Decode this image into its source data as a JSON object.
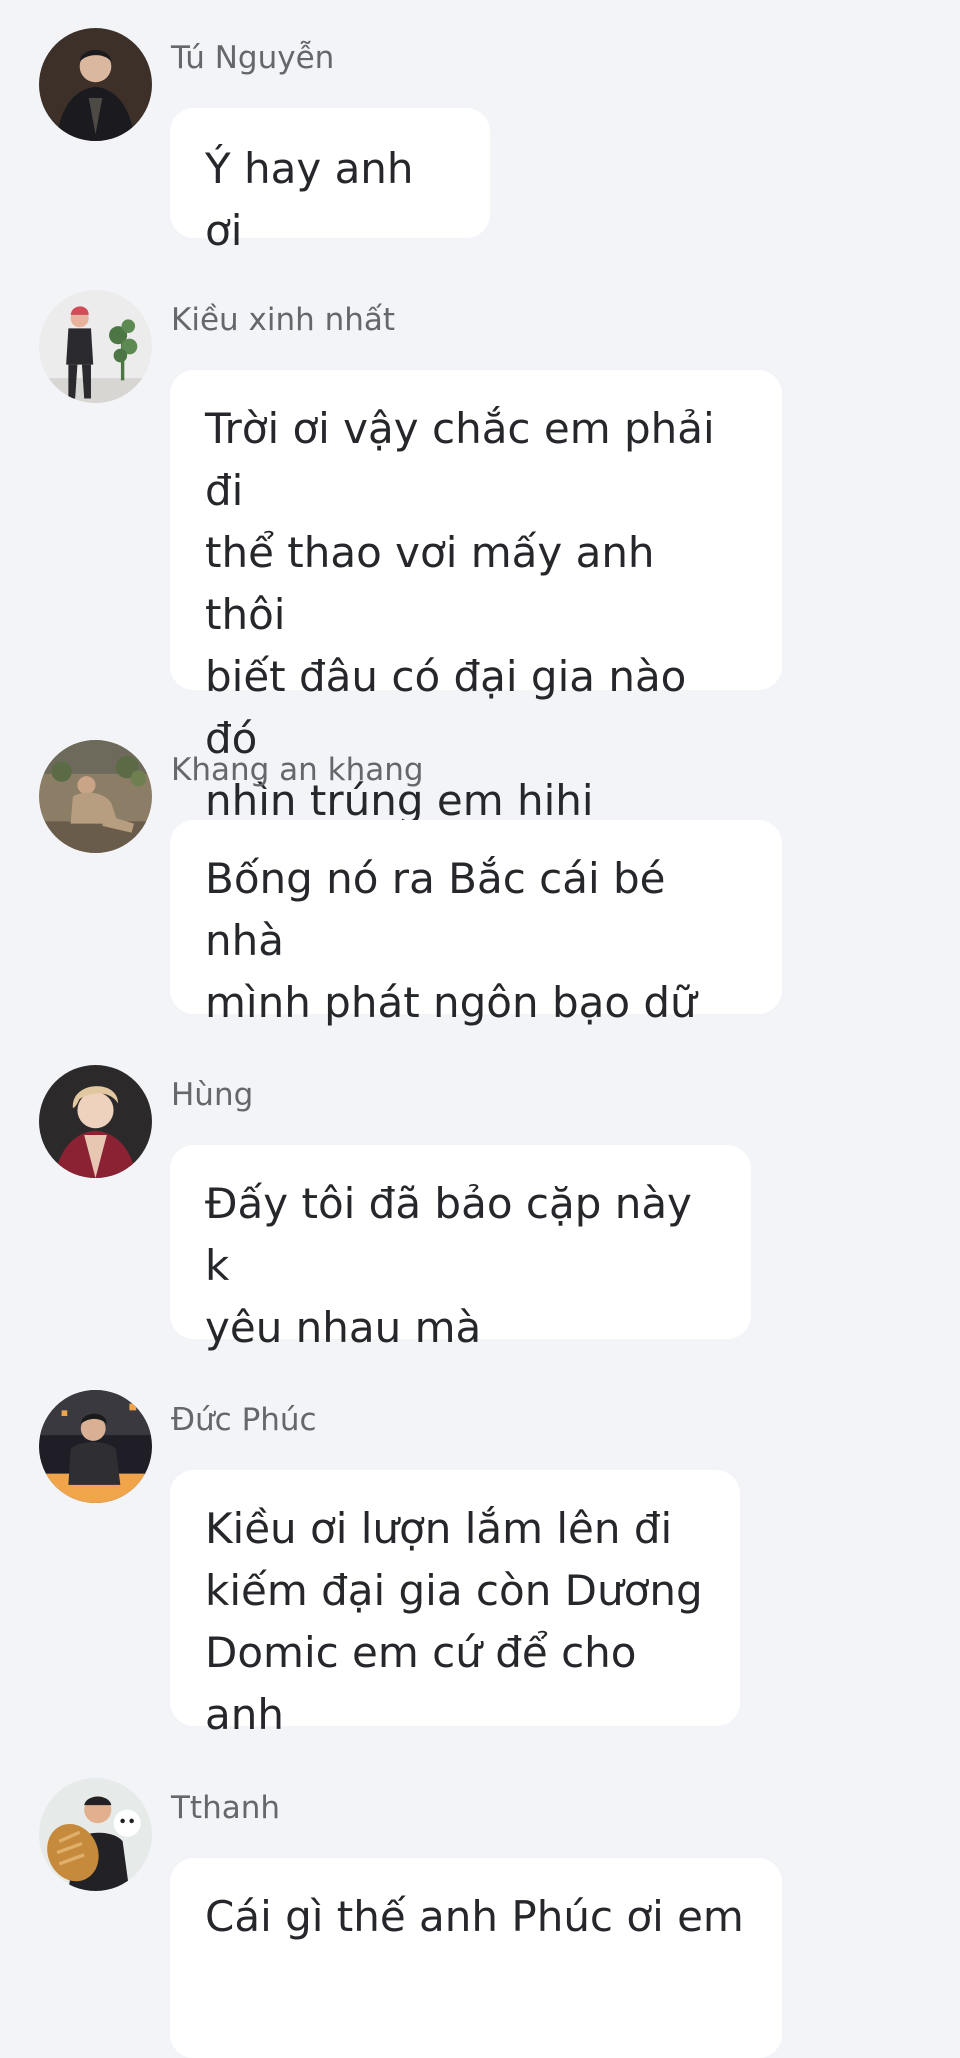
{
  "messages": [
    {
      "sender": "Tú Nguyễn",
      "text": "Ý hay anh ơi",
      "avatar": "avatar-man-dark-shirt",
      "avatar_colors": [
        "#1b1a1f",
        "#3c3029",
        "#dab79f"
      ]
    },
    {
      "sender": "Kiều xinh nhất",
      "text": "Trời ơi vậy chắc em phải đi\nthể thao vơi mấy anh thôi\nbiết đâu có đại gia nào đó\nnhìn trúng em hihi",
      "avatar": "avatar-person-with-plant",
      "avatar_colors": [
        "#ececec",
        "#2b2b2f",
        "#4c7643"
      ]
    },
    {
      "sender": "Khang an khang",
      "text": "Bống nó ra Bắc cái bé nhà\nmình phát ngôn bạo dữ",
      "avatar": "avatar-person-sitting-room",
      "avatar_colors": [
        "#8c7d67",
        "#b79e80",
        "#5b6b45"
      ]
    },
    {
      "sender": "Hùng",
      "text": "Đấy tôi đã bảo cặp này k\nyêu nhau mà",
      "avatar": "avatar-blonde-man",
      "avatar_colors": [
        "#2b2929",
        "#e1c8a0",
        "#8a2234"
      ]
    },
    {
      "sender": "Đức Phúc",
      "text": "Kiều ơi lượn lắm lên đi\nkiếm đại gia còn Dương\nDomic em cứ để cho anh",
      "avatar": "avatar-man-evening-city",
      "avatar_colors": [
        "#1f1e26",
        "#f0a54a",
        "#3a3940"
      ]
    },
    {
      "sender": "Tthanh",
      "text": "Cái gì thế anh Phúc ơi em",
      "avatar": "avatar-man-with-bread",
      "avatar_colors": [
        "#e6ebea",
        "#c58a3c",
        "#222226"
      ]
    }
  ]
}
